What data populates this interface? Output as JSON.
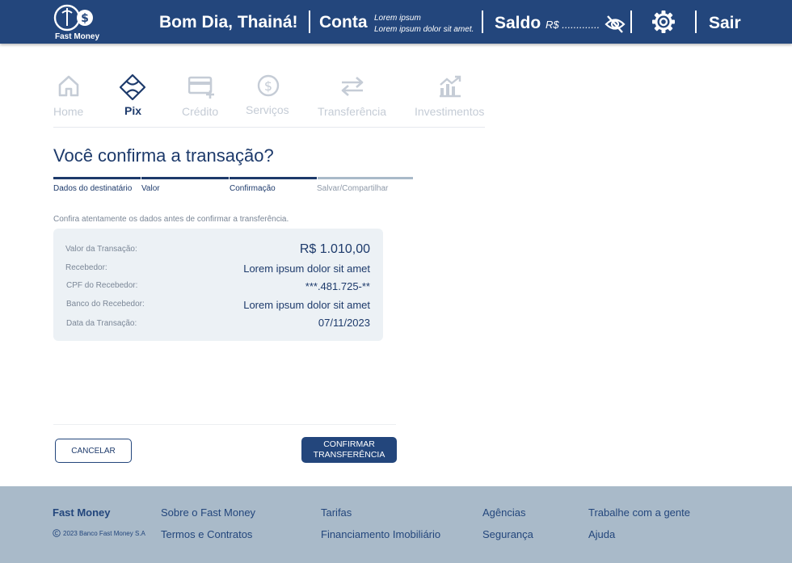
{
  "header": {
    "logo_text": "Fast Money",
    "greeting": "Bom Dia, Thainá!",
    "conta_label": "Conta",
    "conta_line1": "Lorem ipsum",
    "conta_line2": "Lorem ipsum dolor sit amet.",
    "saldo_label": "Saldo",
    "saldo_value": "R$ .............",
    "sair_label": "Sair"
  },
  "nav": {
    "items": [
      {
        "label": "Home"
      },
      {
        "label": "Pix"
      },
      {
        "label": "Crédito"
      },
      {
        "label": "Serviços"
      },
      {
        "label": "Transferência"
      },
      {
        "label": "Investimentos"
      }
    ]
  },
  "page": {
    "title": "Você confirma a transação?",
    "instructions": "Confira atentamente os dados antes de confirmar a transferência."
  },
  "steps": [
    {
      "label": "Dados do destinatário"
    },
    {
      "label": "Valor"
    },
    {
      "label": "Confirmação"
    },
    {
      "label": "Salvar/Compartilhar"
    }
  ],
  "details": [
    {
      "label": "Valor da Transação:",
      "value": "R$ 1.010,00"
    },
    {
      "label": "Recebedor:",
      "value": "Lorem ipsum dolor sit amet"
    },
    {
      "label": "CPF do Recebedor:",
      "value": "***.481.725-**"
    },
    {
      "label": "Banco do Recebedor:",
      "value": "Lorem ipsum dolor sit amet"
    },
    {
      "label": "Data da Transação:",
      "value": "07/11/2023"
    }
  ],
  "actions": {
    "cancel_label": "CANCELAR",
    "confirm_line1": "CONFIRMAR",
    "confirm_line2": "TRANSFERÊNCIA"
  },
  "footer": {
    "brand": "Fast Money",
    "copyright": "2023 Banco Fast Money S.A",
    "links": [
      {
        "label": "Sobre o Fast Money"
      },
      {
        "label": "Termos e Contratos"
      },
      {
        "label": "Tarifas"
      },
      {
        "label": "Financiamento Imobiliário"
      },
      {
        "label": "Agências"
      },
      {
        "label": "Segurança"
      },
      {
        "label": "Trabalhe com a gente"
      },
      {
        "label": "Ajuda"
      }
    ]
  },
  "colors": {
    "primary": "#23467c",
    "text": "#1d3a6b",
    "inactive": "#c5ccd6",
    "card": "#ecf1f5",
    "footer": "#a9bac9"
  }
}
